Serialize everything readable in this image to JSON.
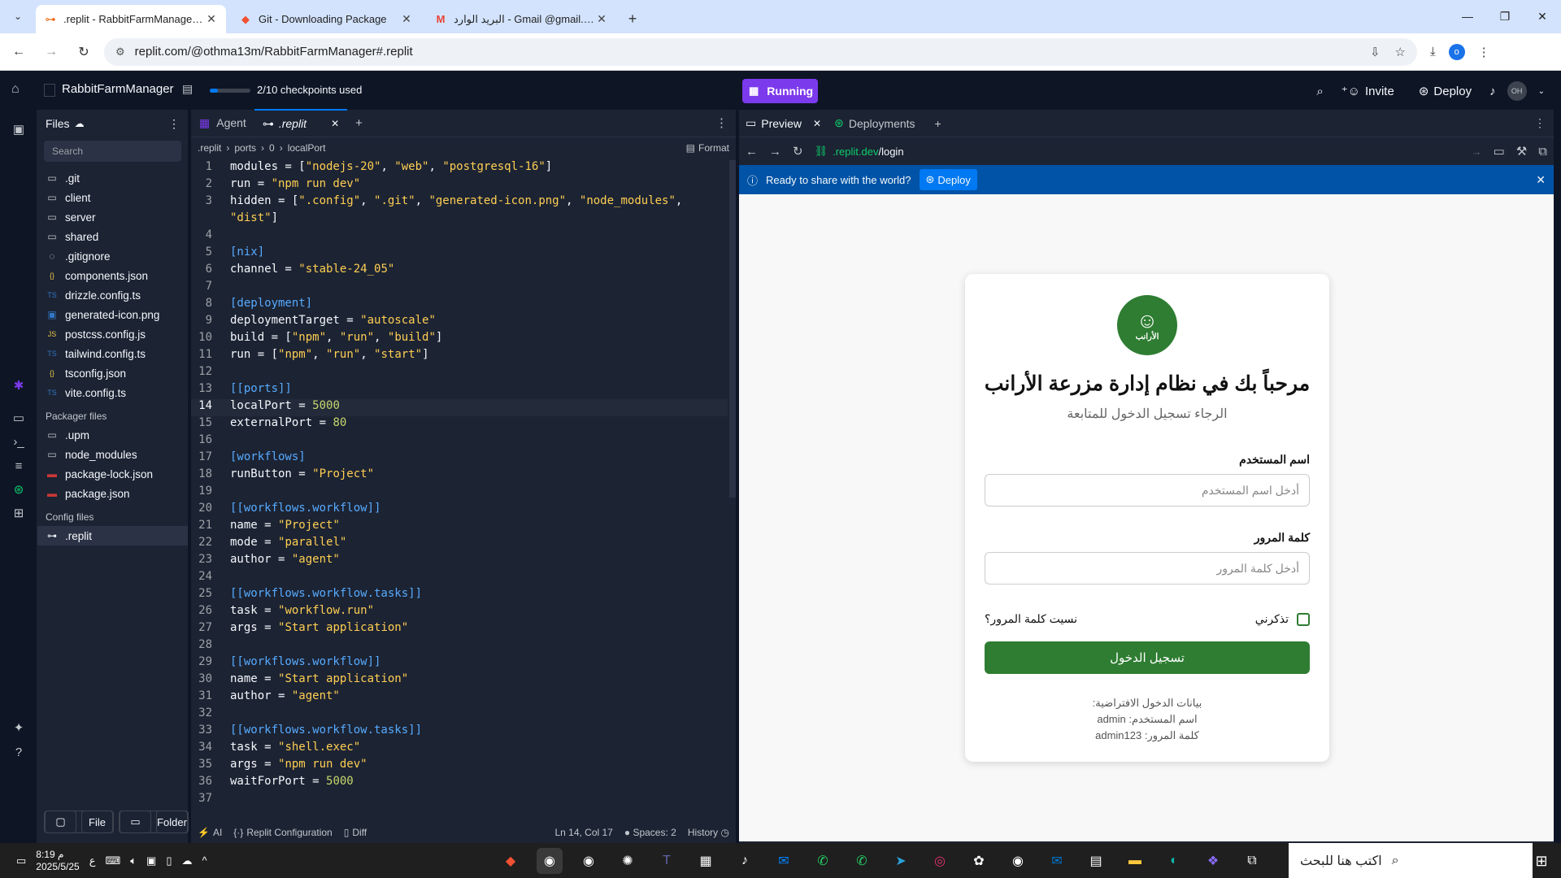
{
  "browser": {
    "tabs": [
      {
        "title": ".replit - RabbitFarmManager - R",
        "icon": "replit-icon",
        "active": true
      },
      {
        "title": "Git - Downloading Package",
        "icon": "git-icon",
        "active": false
      },
      {
        "title": "البريد الوارد - Gmail @gmail.com",
        "icon": "gmail-icon",
        "active": false
      }
    ],
    "url": "replit.com/@othma13m/RabbitFarmManager#.replit",
    "profile_initial": "o"
  },
  "replit": {
    "project_name": "RabbitFarmManager",
    "checkpoints_text": "2/10 checkpoints used",
    "checkpoints_progress": 0.2,
    "run_label": "Running",
    "invite_label": "Invite",
    "deploy_label": "Deploy",
    "avatar_initials": "OH",
    "files": {
      "header": "Files",
      "search_placeholder": "Search",
      "items": [
        {
          "name": ".git",
          "icon": "folder-icon"
        },
        {
          "name": "client",
          "icon": "folder-icon"
        },
        {
          "name": "server",
          "icon": "folder-icon"
        },
        {
          "name": "shared",
          "icon": "folder-icon"
        },
        {
          "name": ".gitignore",
          "icon": "file-icon"
        },
        {
          "name": "components.json",
          "icon": "json-icon"
        },
        {
          "name": "drizzle.config.ts",
          "icon": "ts-icon"
        },
        {
          "name": "generated-icon.png",
          "icon": "image-icon"
        },
        {
          "name": "postcss.config.js",
          "icon": "js-icon"
        },
        {
          "name": "tailwind.config.ts",
          "icon": "ts-icon"
        },
        {
          "name": "tsconfig.json",
          "icon": "json-icon"
        },
        {
          "name": "vite.config.ts",
          "icon": "ts-icon"
        }
      ],
      "packager_title": "Packager files",
      "packager_items": [
        {
          "name": ".upm",
          "icon": "folder-icon"
        },
        {
          "name": "node_modules",
          "icon": "folder-icon"
        },
        {
          "name": "package-lock.json",
          "icon": "npm-icon"
        },
        {
          "name": "package.json",
          "icon": "npm-icon"
        }
      ],
      "config_title": "Config files",
      "config_items": [
        {
          "name": ".replit",
          "icon": "replit-file-icon"
        }
      ],
      "file_button": "File",
      "folder_button": "Folder"
    },
    "editor": {
      "tabs": [
        {
          "label": "Agent"
        },
        {
          "label": ".replit"
        }
      ],
      "breadcrumb": [
        ".replit",
        "ports",
        "0",
        "localPort"
      ],
      "format_label": "Format",
      "current_line": 14,
      "lines": [
        "modules = [\"nodejs-20\", \"web\", \"postgresql-16\"]",
        "run = \"npm run dev\"",
        "hidden = [\".config\", \".git\", \"generated-icon.png\", \"node_modules\",",
        "\"dist\"]",
        "",
        "[nix]",
        "channel = \"stable-24_05\"",
        "",
        "[deployment]",
        "deploymentTarget = \"autoscale\"",
        "build = [\"npm\", \"run\", \"build\"]",
        "run = [\"npm\", \"run\", \"start\"]",
        "",
        "[[ports]]",
        "localPort = 5000",
        "externalPort = 80",
        "",
        "[workflows]",
        "runButton = \"Project\"",
        "",
        "[[workflows.workflow]]",
        "name = \"Project\"",
        "mode = \"parallel\"",
        "author = \"agent\"",
        "",
        "[[workflows.workflow.tasks]]",
        "task = \"workflow.run\"",
        "args = \"Start application\"",
        "",
        "[[workflows.workflow]]",
        "name = \"Start application\"",
        "author = \"agent\"",
        "",
        "[[workflows.workflow.tasks]]",
        "task = \"shell.exec\"",
        "args = \"npm run dev\"",
        "waitForPort = 5000",
        ""
      ],
      "line_numbers": [
        "1",
        "2",
        "3",
        "",
        "4",
        "5",
        "6",
        "7",
        "8",
        "9",
        "10",
        "11",
        "12",
        "13",
        "14",
        "15",
        "16",
        "17",
        "18",
        "19",
        "20",
        "21",
        "22",
        "23",
        "24",
        "25",
        "26",
        "27",
        "28",
        "29",
        "30",
        "31",
        "32",
        "33",
        "34",
        "35",
        "36",
        "37"
      ],
      "footer": {
        "ai": "AI",
        "config": "Replit Configuration",
        "diff": "Diff",
        "position": "Ln 14, Col 17",
        "spaces": "Spaces: 2",
        "history": "History"
      }
    },
    "preview": {
      "tabs": [
        {
          "label": "Preview"
        },
        {
          "label": "Deployments"
        }
      ],
      "url_host": ".replit.dev",
      "url_path": "/login",
      "banner_text": "Ready to share with the world?",
      "banner_button": "Deploy",
      "login": {
        "logo_text": "الأرانب",
        "title": "مرحباً بك في نظام إدارة مزرعة الأرانب",
        "subtitle": "الرجاء تسجيل الدخول للمتابعة",
        "username_label": "اسم المستخدم",
        "username_placeholder": "أدخل اسم المستخدم",
        "password_label": "كلمة المرور",
        "password_placeholder": "أدخل كلمة المرور",
        "remember_label": "تذكرني",
        "forgot_label": "نسيت كلمة المرور؟",
        "login_button": "تسجيل الدخول",
        "defaults_title": "بيانات الدخول الافتراضية:",
        "defaults_user": "اسم المستخدم: admin",
        "defaults_pass": "كلمة المرور: admin123"
      }
    }
  },
  "taskbar": {
    "time": "8:19 م",
    "date": "2025/5/25",
    "search_placeholder": "اكتب هنا للبحث",
    "lang": "ع"
  }
}
